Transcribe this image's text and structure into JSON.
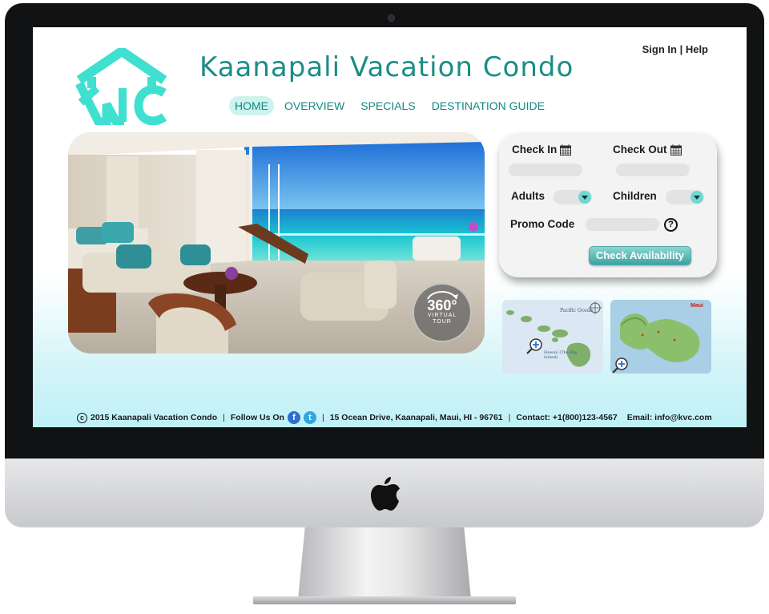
{
  "site": {
    "logo_text": "KVC",
    "title": "Kaanapali Vacation Condo"
  },
  "auth": {
    "sign_in": "Sign In",
    "divider": "|",
    "help": "Help"
  },
  "nav": [
    {
      "label": "HOME",
      "active": true
    },
    {
      "label": "OVERVIEW",
      "active": false
    },
    {
      "label": "SPECIALS",
      "active": false
    },
    {
      "label": "DESTINATION GUIDE",
      "active": false
    }
  ],
  "hero": {
    "tour_number": "360",
    "tour_degree": "°",
    "tour_label_1": "VIRTUAL",
    "tour_label_2": "TOUR"
  },
  "booking": {
    "check_in_label": "Check In",
    "check_in_value": "",
    "check_out_label": "Check Out",
    "check_out_value": "",
    "adults_label": "Adults",
    "adults_value": "",
    "children_label": "Children",
    "children_value": "",
    "promo_label": "Promo Code",
    "promo_value": "",
    "help_glyph": "?",
    "submit_label": "Check Availability"
  },
  "maps": {
    "hawaii_label": "Pacific Ocean",
    "hawaii_island_label": "Hawaii (The Big Island)",
    "maui_label": "Maui"
  },
  "footer": {
    "copyright": "2015 Kaanapali Vacation Condo",
    "follow_label": "Follow Us On",
    "address": "15 Ocean Drive, Kaanapali, Maui, HI - 96761",
    "contact": "Contact: +1(800)123-4567",
    "email": "Email: info@kvc.com",
    "sep": "|",
    "facebook_glyph": "f",
    "twitter_glyph": "t"
  },
  "colors": {
    "brand_teal": "#1a8e86",
    "accent_mint": "#3fe0cf",
    "button_teal": "#3aa3a0"
  }
}
